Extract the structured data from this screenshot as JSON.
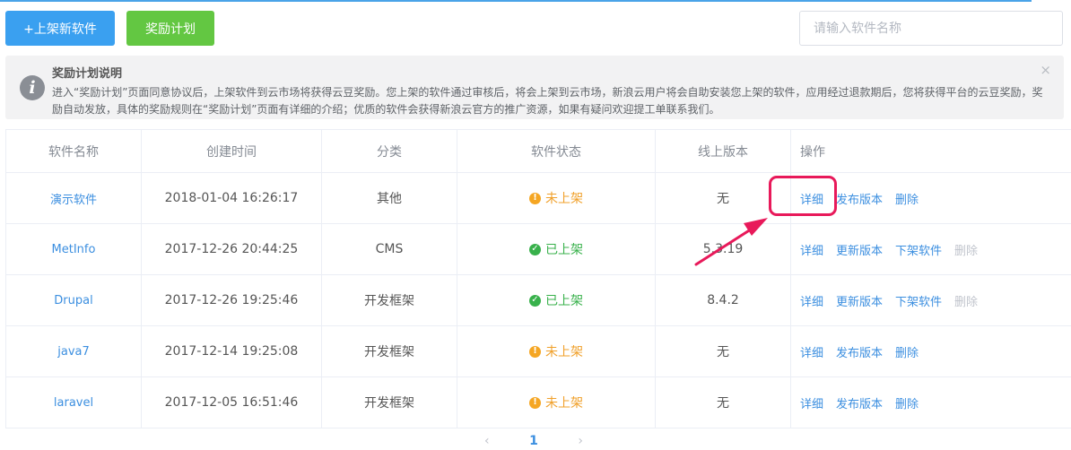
{
  "toolbar": {
    "publish_label": "+上架新软件",
    "reward_label": "奖励计划",
    "search_placeholder": "请输入软件名称"
  },
  "notice": {
    "title": "奖励计划说明",
    "text": "进入“奖励计划”页面同意协议后，上架软件到云市场将获得云豆奖励。您上架的软件通过审核后，将会上架到云市场，新浪云用户将会自助安装您上架的软件，应用经过退款期后，您将获得平台的云豆奖励，奖励自动发放，具体的奖励规则在“奖励计划”页面有详细的介绍；优质的软件会获得新浪云官方的推广资源，如果有疑问欢迎提工单联系我们。",
    "close_symbol": "×",
    "icon": "info-icon"
  },
  "table": {
    "headers": [
      "软件名称",
      "创建时间",
      "分类",
      "软件状态",
      "线上版本",
      "操作"
    ],
    "rows": [
      {
        "name": "演示软件",
        "created": "2018-01-04 16:26:17",
        "category": "其他",
        "status": "未上架",
        "status_type": "off",
        "version": "无",
        "ops": [
          {
            "label": "详细",
            "disabled": false
          },
          {
            "label": "发布版本",
            "disabled": false
          },
          {
            "label": "删除",
            "disabled": false
          }
        ]
      },
      {
        "name": "MetInfo",
        "created": "2017-12-26 20:44:25",
        "category": "CMS",
        "status": "已上架",
        "status_type": "on",
        "version": "5.3.19",
        "ops": [
          {
            "label": "详细",
            "disabled": false
          },
          {
            "label": "更新版本",
            "disabled": false
          },
          {
            "label": "下架软件",
            "disabled": false
          },
          {
            "label": "删除",
            "disabled": true
          }
        ]
      },
      {
        "name": "Drupal",
        "created": "2017-12-26 19:25:46",
        "category": "开发框架",
        "status": "已上架",
        "status_type": "on",
        "version": "8.4.2",
        "ops": [
          {
            "label": "详细",
            "disabled": false
          },
          {
            "label": "更新版本",
            "disabled": false
          },
          {
            "label": "下架软件",
            "disabled": false
          },
          {
            "label": "删除",
            "disabled": true
          }
        ]
      },
      {
        "name": "java7",
        "created": "2017-12-14 19:25:08",
        "category": "开发框架",
        "status": "未上架",
        "status_type": "off",
        "version": "无",
        "ops": [
          {
            "label": "详细",
            "disabled": false
          },
          {
            "label": "发布版本",
            "disabled": false
          },
          {
            "label": "删除",
            "disabled": false
          }
        ]
      },
      {
        "name": "laravel",
        "created": "2017-12-05 16:51:46",
        "category": "开发框架",
        "status": "未上架",
        "status_type": "off",
        "version": "无",
        "ops": [
          {
            "label": "详细",
            "disabled": false
          },
          {
            "label": "发布版本",
            "disabled": false
          },
          {
            "label": "删除",
            "disabled": false
          }
        ]
      }
    ]
  },
  "pagination": {
    "prev_symbol": "‹",
    "current": "1",
    "next_symbol": "›"
  },
  "colors": {
    "primary": "#3aa0f0",
    "success": "#63c742",
    "warning": "#f5a623",
    "online": "#38b14b",
    "annotation": "#e8195a"
  }
}
